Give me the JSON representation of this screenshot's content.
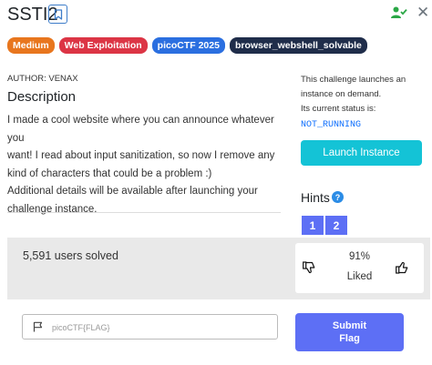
{
  "challenge": {
    "title": "SSTI2",
    "tags": [
      {
        "label": "Medium",
        "color": "#e8761e"
      },
      {
        "label": "Web Exploitation",
        "color": "#dc3545"
      },
      {
        "label": "picoCTF 2025",
        "color": "#2b6fe0"
      },
      {
        "label": "browser_webshell_solvable",
        "color": "#1f2d4a"
      }
    ],
    "author": "AUTHOR: VENAX",
    "description_heading": "Description",
    "description_lines": [
      "I made a cool website where you can announce whatever you",
      "want! I read about input sanitization, so now I remove any",
      "kind of characters that could be a problem :)",
      "Additional details will be available after launching your",
      "challenge instance."
    ]
  },
  "instance": {
    "info_lines": [
      "This challenge launches an",
      "instance on demand.",
      "Its current status is:"
    ],
    "status": "NOT_RUNNING",
    "launch_label": "Launch Instance"
  },
  "hints": {
    "heading": "Hints",
    "help_icon": "?",
    "buttons": [
      "1",
      "2"
    ]
  },
  "stats": {
    "solved": "5,591 users solved",
    "liked_percent": "91%",
    "liked_label": "Liked"
  },
  "flag": {
    "placeholder": "picoCTF{FLAG}",
    "submit_label": "Submit Flag"
  },
  "colors": {
    "accent": "#5d6ff5",
    "launch": "#14c3d6",
    "solved_icon": "#2aa745"
  },
  "icons": {
    "bookmark": "bookmark-icon",
    "user_check": "user-check-icon",
    "close": "close-icon",
    "thumbs_down": "thumbs-down-icon",
    "thumbs_up": "thumbs-up-icon",
    "flag": "flag-icon"
  }
}
